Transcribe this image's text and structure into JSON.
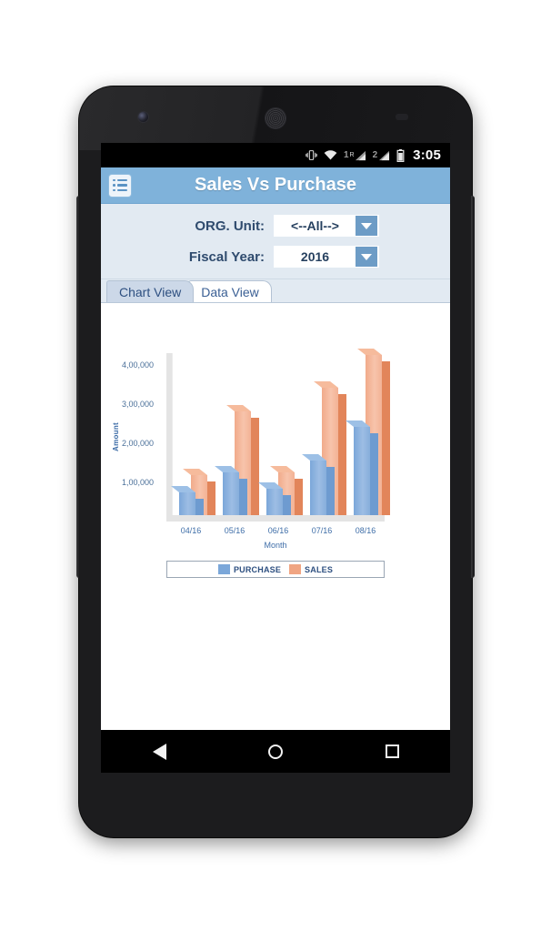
{
  "status_bar": {
    "vibrate_icon": "vibrate-icon",
    "wifi_icon": "wifi-icon",
    "sim1_label": "1",
    "sim1_roaming": "R",
    "sim2_label": "2",
    "battery_icon": "battery-icon",
    "time": "3:05"
  },
  "app_bar": {
    "menu_icon": "list-menu-icon",
    "title": "Sales Vs Purchase"
  },
  "filters": {
    "org_unit": {
      "label": "ORG. Unit:",
      "value": "<--All-->"
    },
    "fiscal_year": {
      "label": "Fiscal Year:",
      "value": "2016"
    }
  },
  "tabs": [
    {
      "label": "Chart View",
      "active": true
    },
    {
      "label": "Data View",
      "active": false
    }
  ],
  "nav_bar": {
    "back": "back-triangle-icon",
    "home": "home-circle-icon",
    "recents": "recents-square-icon"
  },
  "colors": {
    "app_bar": "#7fb2da",
    "panel": "#e2eaf2",
    "purchase": "#7ba7d9",
    "sales": "#f0a583",
    "axis_text": "#3f6ea8"
  },
  "chart_data": {
    "type": "bar",
    "title": "",
    "xlabel": "Month",
    "ylabel": "Amount",
    "categories": [
      "04/16",
      "05/16",
      "06/16",
      "07/16",
      "08/16"
    ],
    "ytick_labels": [
      "1,00,000",
      "2,00,000",
      "3,00,000",
      "4,00,000"
    ],
    "ytick_values": [
      100000,
      200000,
      300000,
      400000
    ],
    "ylim": [
      0,
      430000
    ],
    "grid": false,
    "legend_position": "bottom",
    "series": [
      {
        "name": "PURCHASE",
        "color": "#7ba7d9",
        "values": [
          58000,
          110000,
          68000,
          140000,
          225000
        ]
      },
      {
        "name": "SALES",
        "color": "#f0a583",
        "values": [
          103000,
          265000,
          110000,
          325000,
          410000
        ]
      }
    ]
  }
}
